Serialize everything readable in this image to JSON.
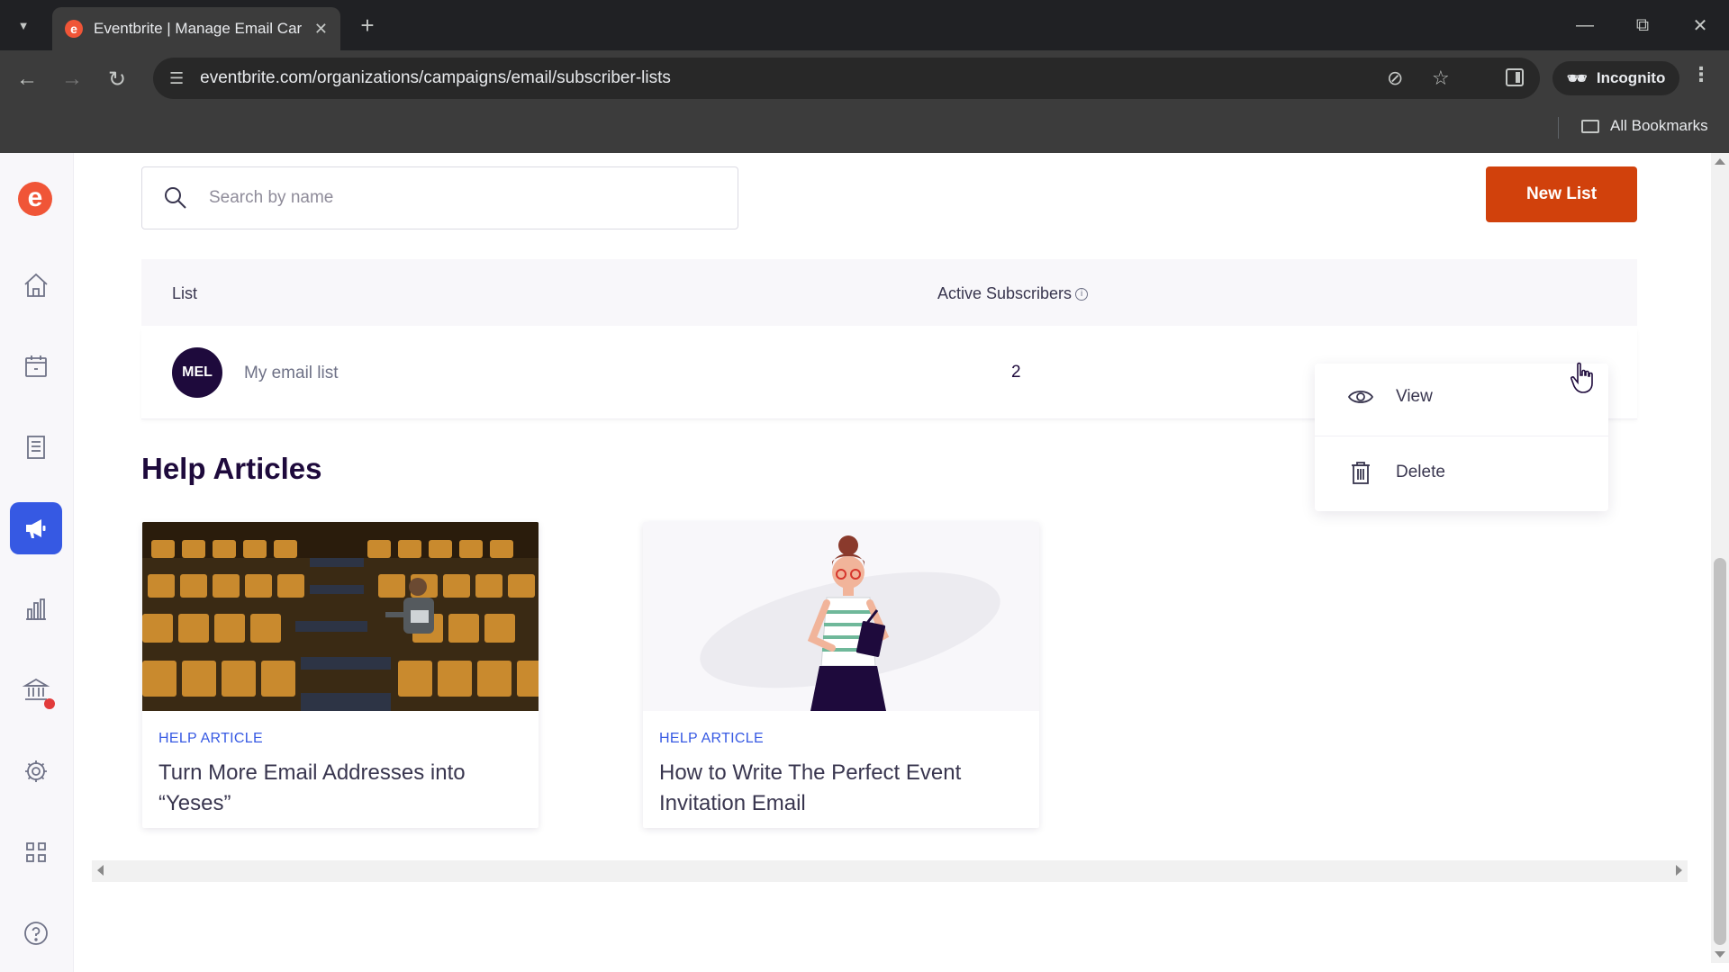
{
  "browser": {
    "tab_title": "Eventbrite | Manage Email Car",
    "favicon_letter": "e",
    "url": "eventbrite.com/organizations/campaigns/email/subscriber-lists",
    "incognito_label": "Incognito",
    "all_bookmarks_label": "All Bookmarks"
  },
  "sidebar": {
    "logo_letter": "e",
    "items": [
      {
        "name": "home-icon",
        "active": false
      },
      {
        "name": "calendar-icon",
        "active": false
      },
      {
        "name": "orders-icon",
        "active": false
      },
      {
        "name": "megaphone-icon",
        "active": true
      },
      {
        "name": "bar-chart-icon",
        "active": false
      },
      {
        "name": "bank-icon",
        "active": false
      },
      {
        "name": "gear-icon",
        "active": false
      },
      {
        "name": "apps-grid-icon",
        "active": false
      },
      {
        "name": "help-icon",
        "active": false
      }
    ]
  },
  "search": {
    "placeholder": "Search by name",
    "value": ""
  },
  "new_list_label": "New List",
  "table": {
    "col_list": "List",
    "col_active": "Active Subscribers",
    "rows": [
      {
        "initials": "MEL",
        "name": "My email list",
        "active_subscribers": "2"
      }
    ]
  },
  "menu": {
    "view_label": "View",
    "delete_label": "Delete"
  },
  "help": {
    "heading": "Help Articles",
    "articles": [
      {
        "kicker": "HELP ARTICLE",
        "title": "Turn More Email Addresses into “Yeses”"
      },
      {
        "kicker": "HELP ARTICLE",
        "title": "How to Write The Perfect Event Invitation Email"
      }
    ]
  },
  "colors": {
    "brand_orange": "#f05537",
    "button_orange": "#d1410c",
    "active_blue": "#3659e3",
    "ink": "#1e0a3c"
  }
}
